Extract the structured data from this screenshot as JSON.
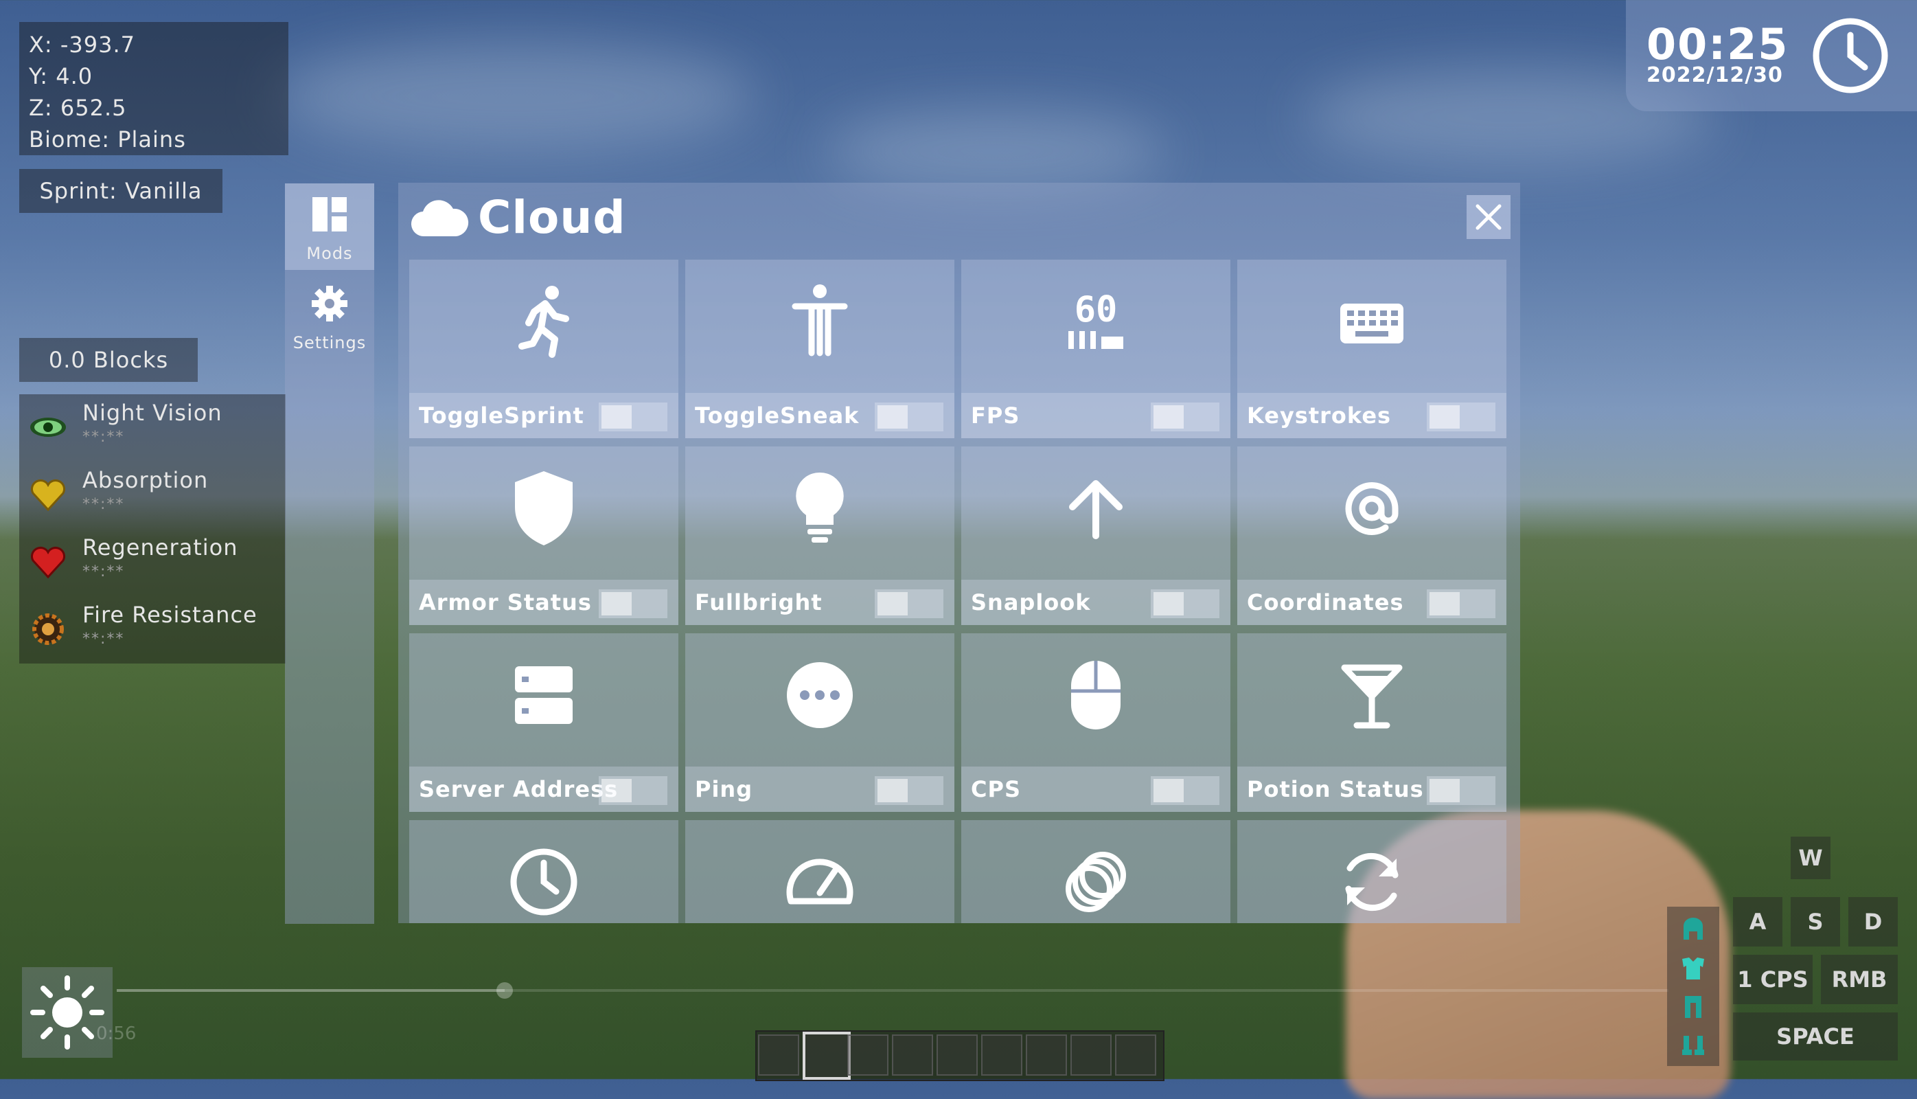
{
  "hud": {
    "coordinates": {
      "x": "X: -393.7",
      "y": "Y: 4.0",
      "z": "Z: 652.5",
      "biome": "Biome: Plains"
    },
    "sprint_status": "Sprint: Vanilla",
    "blocks": "0.0 Blocks",
    "effects": [
      {
        "name": "Night Vision",
        "duration": "**:**",
        "icon": "eye-icon",
        "color": "#2f7a2f"
      },
      {
        "name": "Absorption",
        "duration": "**:**",
        "icon": "gold-heart-icon",
        "color": "#d8b31e"
      },
      {
        "name": "Regeneration",
        "duration": "**:**",
        "icon": "red-heart-icon",
        "color": "#d42020"
      },
      {
        "name": "Fire Resistance",
        "duration": "**:**",
        "icon": "fire-resistance-icon",
        "color": "#c8741e"
      }
    ],
    "clock": {
      "time": "00:25",
      "date": "2022/12/30"
    }
  },
  "sidebar": {
    "items": [
      {
        "label": "Mods",
        "icon": "mods-grid-icon",
        "active": true
      },
      {
        "label": "Settings",
        "icon": "gear-icon",
        "active": false
      }
    ]
  },
  "panel": {
    "title": "Cloud",
    "logo_icon": "cloud-icon",
    "close_icon": "close-icon",
    "mods": [
      {
        "name": "ToggleSprint",
        "icon": "running-person-icon",
        "enabled": false
      },
      {
        "name": "ToggleSneak",
        "icon": "standing-person-icon",
        "enabled": false
      },
      {
        "name": "FPS",
        "icon": "fps-60-icon",
        "icon_text": "60",
        "enabled": false
      },
      {
        "name": "Keystrokes",
        "icon": "keyboard-icon",
        "enabled": false
      },
      {
        "name": "Armor Status",
        "icon": "shield-icon",
        "enabled": false
      },
      {
        "name": "Fullbright",
        "icon": "lightbulb-icon",
        "enabled": false
      },
      {
        "name": "Snaplook",
        "icon": "arrow-up-icon",
        "enabled": false
      },
      {
        "name": "Coordinates",
        "icon": "at-sign-icon",
        "enabled": false
      },
      {
        "name": "Server Address",
        "icon": "server-icon",
        "enabled": false
      },
      {
        "name": "Ping",
        "icon": "ellipsis-circle-icon",
        "enabled": false
      },
      {
        "name": "CPS",
        "icon": "mouse-icon",
        "enabled": false
      },
      {
        "name": "Potion Status",
        "icon": "cocktail-glass-icon",
        "enabled": false
      },
      {
        "name": "",
        "icon": "clock-icon",
        "enabled": false
      },
      {
        "name": "",
        "icon": "speedometer-icon",
        "enabled": false
      },
      {
        "name": "",
        "icon": "rings-icon",
        "enabled": false
      },
      {
        "name": "",
        "icon": "refresh-icon",
        "enabled": false
      }
    ]
  },
  "keystrokes": {
    "w": "W",
    "a": "A",
    "s": "S",
    "d": "D",
    "cps": "1 CPS",
    "rmb": "RMB",
    "space": "SPACE"
  },
  "video": {
    "elapsed": "0:56",
    "progress": 0.25
  },
  "hotbar": {
    "slots": 9,
    "selected": 1
  },
  "colors": {
    "panel": "#96a5c8",
    "accent": "#ffffff"
  }
}
